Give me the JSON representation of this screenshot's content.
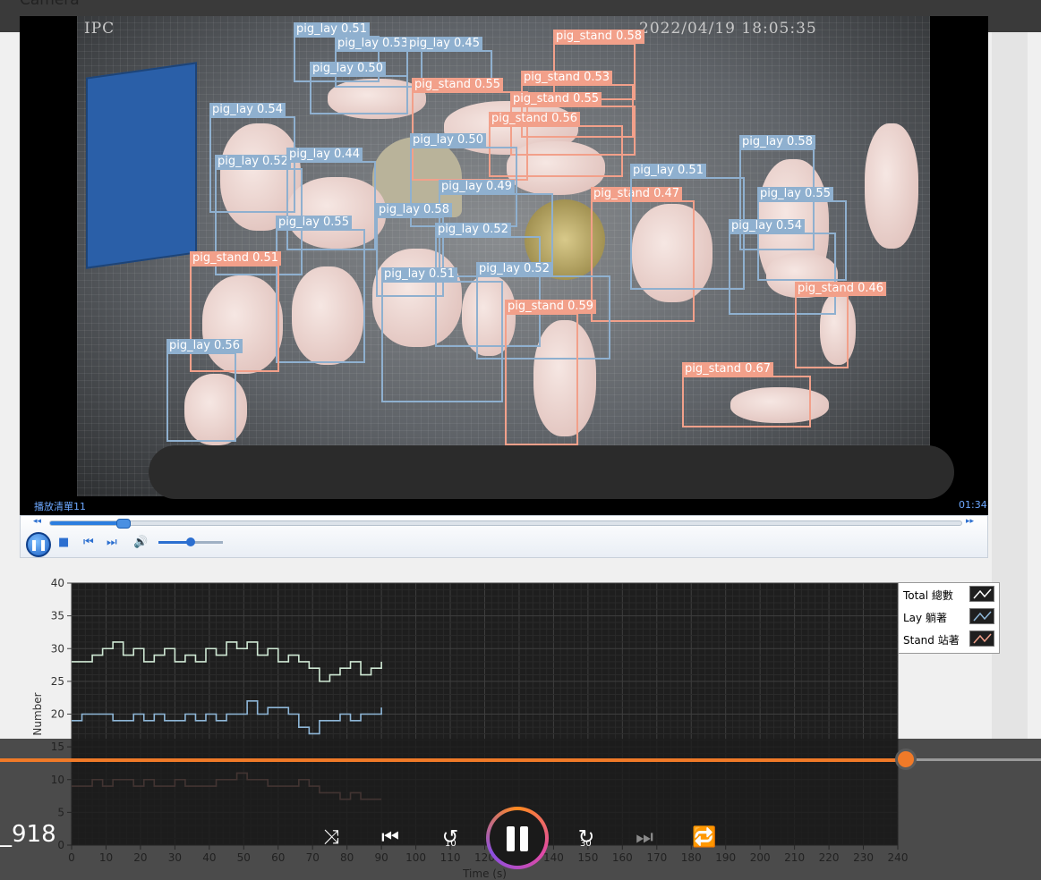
{
  "panel": {
    "label": "Camera"
  },
  "video": {
    "osd_left": "IPC",
    "osd_timestamp": "2022/04/19 18:05:35",
    "playlist_label": "播放清單11",
    "duration": "01:34",
    "seek_progress": 0.08,
    "volume_level": 0.5,
    "detections": [
      {
        "label": "pig_lay 0.51",
        "cls": "lay"
      },
      {
        "label": "pig_lay 0.53",
        "cls": "lay"
      },
      {
        "label": "pig_lay 0.45",
        "cls": "lay"
      },
      {
        "label": "pig_lay 0.50",
        "cls": "lay"
      },
      {
        "label": "pig_stand 0.58",
        "cls": "stand"
      },
      {
        "label": "pig_stand 0.55",
        "cls": "stand"
      },
      {
        "label": "pig_stand 0.53",
        "cls": "stand"
      },
      {
        "label": "pig_stand 0.55",
        "cls": "stand"
      },
      {
        "label": "pig_stand 0.56",
        "cls": "stand"
      },
      {
        "label": "pig_lay 0.54",
        "cls": "lay"
      },
      {
        "label": "pig_lay 0.50",
        "cls": "lay"
      },
      {
        "label": "pig_lay 0.52",
        "cls": "lay"
      },
      {
        "label": "pig_lay 0.44",
        "cls": "lay"
      },
      {
        "label": "pig_lay 0.49",
        "cls": "lay"
      },
      {
        "label": "pig_lay 0.58",
        "cls": "lay"
      },
      {
        "label": "pig_stand 0.47",
        "cls": "stand"
      },
      {
        "label": "pig_lay 0.51",
        "cls": "lay"
      },
      {
        "label": "pig_lay 0.58",
        "cls": "lay"
      },
      {
        "label": "pig_lay 0.55",
        "cls": "lay"
      },
      {
        "label": "pig_lay 0.55",
        "cls": "lay"
      },
      {
        "label": "pig_lay 0.52",
        "cls": "lay"
      },
      {
        "label": "pig_lay 0.54",
        "cls": "lay"
      },
      {
        "label": "pig_stand 0.51",
        "cls": "stand"
      },
      {
        "label": "pig_lay 0.51",
        "cls": "lay"
      },
      {
        "label": "pig_lay 0.52",
        "cls": "lay"
      },
      {
        "label": "pig_stand 0.46",
        "cls": "stand"
      },
      {
        "label": "pig_stand 0.59",
        "cls": "stand"
      },
      {
        "label": "pig_lay 0.56",
        "cls": "lay"
      },
      {
        "label": "pig_stand 0.67",
        "cls": "stand"
      }
    ]
  },
  "chart_data": {
    "type": "line",
    "xlabel": "Time (s)",
    "ylabel": "Number",
    "xlim": [
      0,
      240
    ],
    "ylim": [
      0,
      40
    ],
    "xticks": [
      0,
      10,
      20,
      30,
      40,
      50,
      60,
      70,
      80,
      90,
      100,
      110,
      120,
      130,
      140,
      150,
      160,
      170,
      180,
      190,
      200,
      210,
      220,
      230,
      240
    ],
    "yticks": [
      0,
      5,
      10,
      15,
      20,
      25,
      30,
      35,
      40
    ],
    "grid": true,
    "legend_position": "top-right",
    "x": [
      0,
      3,
      6,
      9,
      12,
      15,
      18,
      21,
      24,
      27,
      30,
      33,
      36,
      39,
      42,
      45,
      48,
      51,
      54,
      57,
      60,
      63,
      66,
      69,
      72,
      75,
      78,
      81,
      84,
      87,
      90
    ],
    "series": [
      {
        "name": "Total 總數",
        "color": "#cfe8d4",
        "values": [
          28,
          28,
          29,
          30,
          31,
          29,
          30,
          28,
          29,
          30,
          28,
          29,
          28,
          30,
          29,
          31,
          30,
          31,
          29,
          30,
          28,
          29,
          28,
          27,
          25,
          26,
          27,
          28,
          26,
          27,
          28
        ]
      },
      {
        "name": "Lay 躺著",
        "color": "#8fb7d8",
        "values": [
          19,
          20,
          20,
          20,
          19,
          19,
          20,
          19,
          20,
          19,
          19,
          20,
          19,
          20,
          19,
          20,
          20,
          22,
          20,
          21,
          21,
          20,
          18,
          17,
          19,
          19,
          20,
          19,
          20,
          20,
          21
        ]
      },
      {
        "name": "Stand 站著",
        "color": "#c98a7e",
        "values": [
          9,
          9,
          10,
          9,
          10,
          10,
          9,
          10,
          9,
          9,
          10,
          9,
          9,
          9,
          10,
          10,
          11,
          10,
          10,
          9,
          9,
          9,
          10,
          9,
          8,
          8,
          7,
          8,
          7,
          7,
          7
        ]
      }
    ]
  },
  "media_player": {
    "title": "_918",
    "progress": 0.87,
    "rewind_seconds": "10",
    "forward_seconds": "30"
  }
}
